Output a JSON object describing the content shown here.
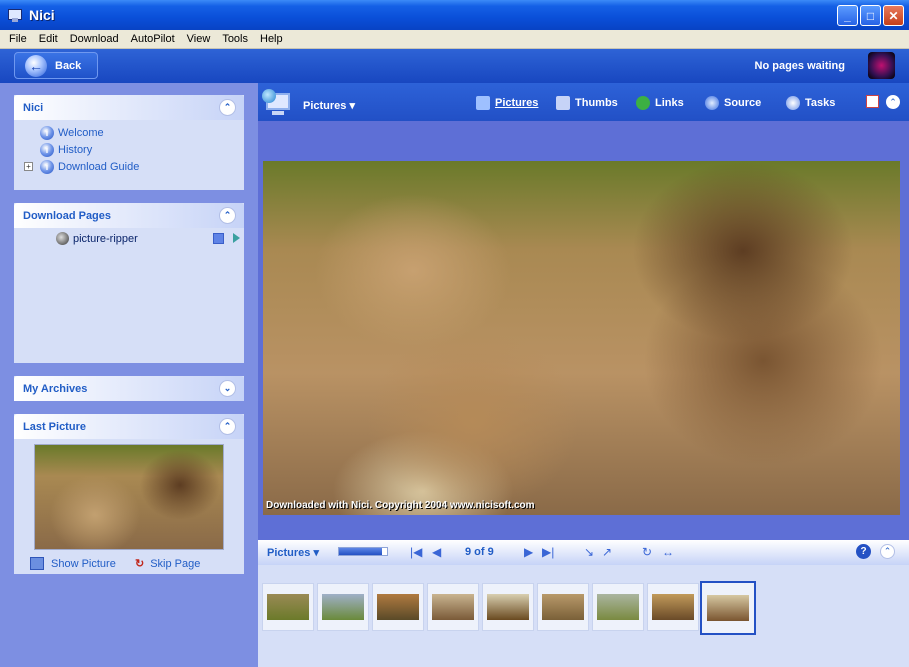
{
  "window": {
    "title": "Nici"
  },
  "window_buttons": {
    "minimize": "_",
    "maximize": "□",
    "close": "✕"
  },
  "menu": [
    "File",
    "Edit",
    "Download",
    "AutoPilot",
    "View",
    "Tools",
    "Help"
  ],
  "toolbar": {
    "back_label": "Back",
    "status": "No pages waiting"
  },
  "sidebar": {
    "nici": {
      "title": "Nici",
      "links": [
        "Welcome",
        "History",
        "Download Guide"
      ]
    },
    "download_pages": {
      "title": "Download Pages",
      "items": [
        "picture-ripper"
      ]
    },
    "archives": {
      "title": "My Archives"
    },
    "last_picture": {
      "title": "Last Picture",
      "show_label": "Show Picture",
      "skip_label": "Skip Page"
    }
  },
  "viewbar": {
    "title": "Pictures",
    "tabs": [
      "Pictures",
      "Thumbs",
      "Links",
      "Source",
      "Tasks"
    ]
  },
  "picture": {
    "caption": "Downloaded with Nici. Copyright 2004 www.nicisoft.com"
  },
  "navigator": {
    "title": "Pictures",
    "count": "9 of 9",
    "progress": 0.9,
    "help": "?"
  },
  "thumbnails": [
    {
      "name": "thumb-1",
      "colors": [
        "#9a8a55",
        "#6b7a2a"
      ]
    },
    {
      "name": "thumb-2",
      "colors": [
        "#9fb0c8",
        "#6a8a3a"
      ]
    },
    {
      "name": "thumb-3",
      "colors": [
        "#b07a40",
        "#5a4a28"
      ]
    },
    {
      "name": "thumb-4",
      "colors": [
        "#c9b490",
        "#7a5a38"
      ]
    },
    {
      "name": "thumb-5",
      "colors": [
        "#d8cfb0",
        "#6a4a20"
      ]
    },
    {
      "name": "thumb-6",
      "colors": [
        "#b8996a",
        "#7a6038"
      ]
    },
    {
      "name": "thumb-7",
      "colors": [
        "#aab5a0",
        "#7a8a40"
      ]
    },
    {
      "name": "thumb-8",
      "colors": [
        "#c19a5a",
        "#6a4a28"
      ]
    },
    {
      "name": "thumb-9",
      "colors": [
        "#d6c8a2",
        "#7a5530"
      ]
    }
  ],
  "colors": {
    "accent": "#215dc6",
    "title_blue": "#0a4fd8",
    "pane_bg": "#5e6fd6"
  }
}
